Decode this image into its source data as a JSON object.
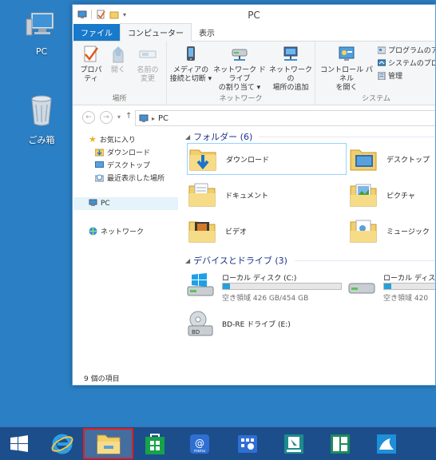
{
  "desktop": {
    "icons": [
      {
        "label": "PC",
        "icon": "computer-icon"
      },
      {
        "label": "ごみ箱",
        "icon": "recycle-bin-icon"
      }
    ]
  },
  "window": {
    "title": "PC",
    "tabs": [
      {
        "label": "ファイル"
      },
      {
        "label": "コンピューター"
      },
      {
        "label": "表示"
      }
    ],
    "ribbon": {
      "groups": [
        {
          "name": "場所",
          "buttons": [
            "プロパティ",
            "開く",
            "名前の変更"
          ]
        },
        {
          "name": "ネットワーク",
          "buttons": [
            "メディアの接続と切断",
            "ネットワーク ドライブの割り当て",
            "ネットワークの場所の追加"
          ]
        },
        {
          "name": "システム",
          "buttons": [
            "コントロール パネルを開く"
          ],
          "small_buttons": [
            "プログラムのアン",
            "システムのプロパ",
            "管理"
          ]
        }
      ],
      "button_texts": {
        "properties": [
          "プロパティ"
        ],
        "open": [
          "開く"
        ],
        "rename": [
          "名前の",
          "変更"
        ],
        "media": [
          "メディアの",
          "接続と切断 ▾"
        ],
        "map_drive": [
          "ネットワーク ドライブ",
          "の割り当て ▾"
        ],
        "add_location": [
          "ネットワークの",
          "場所の追加"
        ],
        "control_panel": [
          "コントロール パネル",
          "を開く"
        ]
      }
    },
    "address": {
      "path": "PC"
    },
    "nav_pane": {
      "favorites": "お気に入り",
      "favorites_items": [
        "ダウンロード",
        "デスクトップ",
        "最近表示した場所"
      ],
      "pc": "PC",
      "network": "ネットワーク"
    },
    "content": {
      "folders_header": "フォルダー (6)",
      "folders": [
        "ダウンロード",
        "デスクトップ",
        "ドキュメント",
        "ピクチャ",
        "ビデオ",
        "ミュージック"
      ],
      "drives_header": "デバイスとドライブ (3)",
      "drives": [
        {
          "name": "ローカル ディスク (C:)",
          "free": "空き領域 426 GB/454 GB",
          "used_fraction": 0.06
        },
        {
          "name": "ローカル ディスク",
          "free": "空き領域 420",
          "used_fraction": 0.06
        },
        {
          "name": "BD-RE ドライブ (E:)"
        }
      ]
    },
    "status": "9 個の項目"
  },
  "taskbar": {
    "items": [
      "start-icon",
      "internet-explorer-icon",
      "file-explorer-icon",
      "store-icon",
      "menu-icon",
      "control-panel-icon",
      "snapping-tool-icon",
      "app-icon",
      "azure-app-icon"
    ]
  },
  "colors": {
    "desktop": "#2b7fc4",
    "taskbar": "#1c4e8c",
    "accent": "#1979ca",
    "highlight_border": "#e21e1e"
  }
}
